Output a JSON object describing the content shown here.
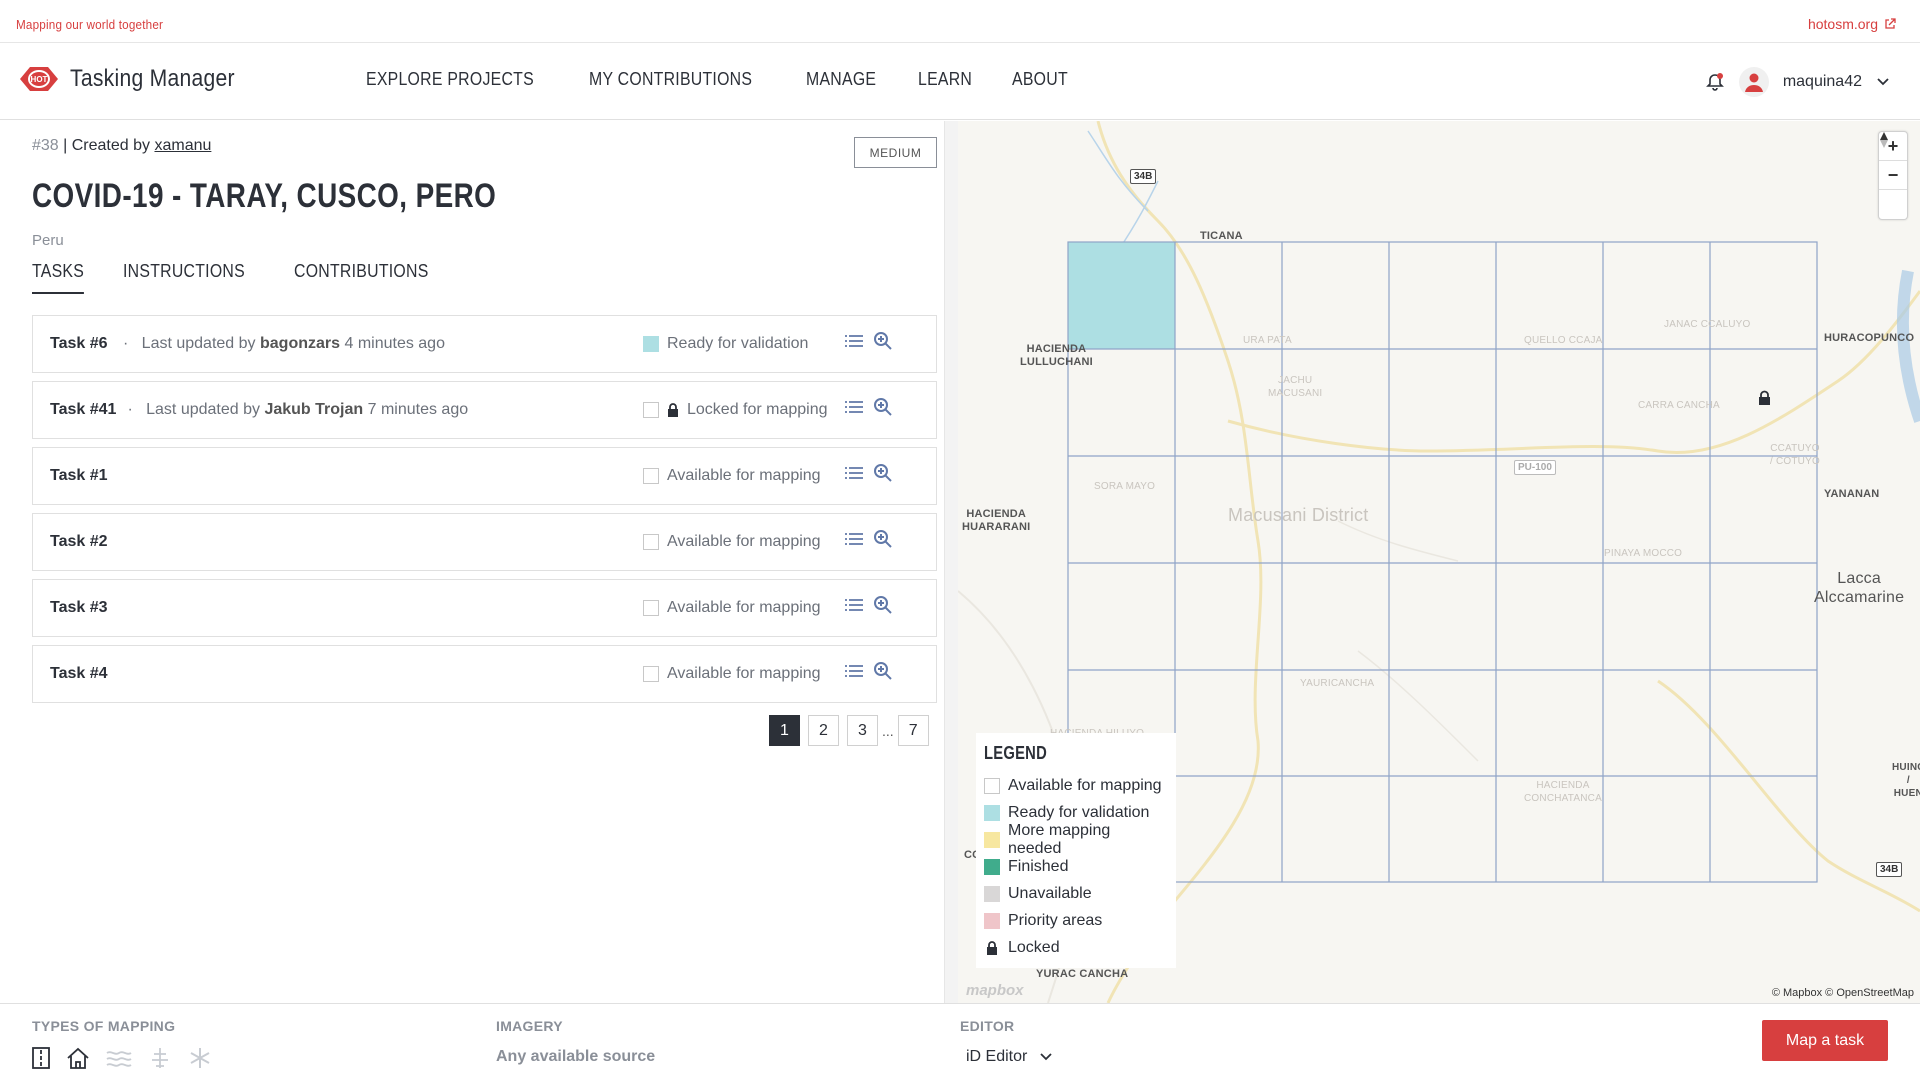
{
  "topbar": {
    "tagline": "Mapping our world together",
    "external_link": "hotosm.org"
  },
  "header": {
    "app_name": "Tasking Manager",
    "logo_text": "HOT",
    "nav": [
      "EXPLORE PROJECTS",
      "MY CONTRIBUTIONS",
      "MANAGE",
      "LEARN",
      "ABOUT"
    ],
    "username": "maquina42"
  },
  "project": {
    "id_label": "#38",
    "created_by_prefix": " | Created by ",
    "creator": "xamanu",
    "difficulty": "MEDIUM",
    "title": "COVID-19 - TARAY, CUSCO, PERO",
    "country": "Peru",
    "tabs": [
      "TASKS",
      "INSTRUCTIONS",
      "CONTRIBUTIONS"
    ]
  },
  "tasks": [
    {
      "name": "Task #6",
      "dot": "·",
      "updated_prefix": "Last updated by",
      "user": "bagonzars",
      "ago": "4 minutes ago",
      "status": "Ready for validation",
      "status_key": "ready",
      "locked": false
    },
    {
      "name": "Task #41",
      "dot": "·",
      "updated_prefix": "Last updated by",
      "user": "Jakub Trojan",
      "ago": "7 minutes ago",
      "status": "Locked for mapping",
      "status_key": "available",
      "locked": true
    },
    {
      "name": "Task #1",
      "status": "Available for mapping",
      "status_key": "available",
      "locked": false
    },
    {
      "name": "Task #2",
      "status": "Available for mapping",
      "status_key": "available",
      "locked": false
    },
    {
      "name": "Task #3",
      "status": "Available for mapping",
      "status_key": "available",
      "locked": false
    },
    {
      "name": "Task #4",
      "status": "Available for mapping",
      "status_key": "available",
      "locked": false
    }
  ],
  "pagination": {
    "pages": [
      "1",
      "2",
      "3"
    ],
    "ellipsis": "...",
    "last": "7",
    "current": "1"
  },
  "map": {
    "labels": {
      "ticana": "TICANA",
      "hacienda_lulluchani": "HACIENDA\nLULLUCHANI",
      "hacienda_huararani": "HACIENDA\nHUARARANI",
      "huracopunco": "HURACOPUNCO",
      "yananan": "YANANAN",
      "lacca": "Lacca\nAlccamarine",
      "district": "Macusani District",
      "yurac_cancha": "YURAC CANCHA",
      "ura_pata": "URA PATA",
      "quello_ccaja": "QUELLO CCAJA",
      "janac_ccaluyo": "JANAC CCALUYO",
      "jachu_macusani": "JACHU\nMACUSANI",
      "carra_cancha": "CARRA CANCHA",
      "ccatuyo": "CCATUYO\n/ COTUYO",
      "sora_mayo": "SORA MAYO",
      "pinaya_mocco": "PINAYA MOCCO",
      "yauricancha": "YAURICANCHA",
      "hacienda_hiluyo": "HACIENDA HILUYO",
      "hacienda_conchatanca": "HACIENDA\nCONCHATANCA",
      "huinc": "HUINC\n/ HUEN",
      "co": "CO"
    },
    "shields": {
      "s1": "34B",
      "s2": "PU-100",
      "s3": "34B"
    },
    "attribution": "© Mapbox © OpenStreetMap",
    "mapbox_logo": "mapbox",
    "colors": {
      "ready": "#addfe3",
      "grid": "#8fa4c8",
      "road": "#f1e4b5"
    }
  },
  "legend": {
    "title": "LEGEND",
    "items": [
      {
        "label": "Available for mapping",
        "color": "#ffffff"
      },
      {
        "label": "Ready for validation",
        "color": "#addfe3"
      },
      {
        "label": "More mapping needed",
        "color": "#f7e7a0"
      },
      {
        "label": "Finished",
        "color": "#40ac8c"
      },
      {
        "label": "Unavailable",
        "color": "#d9d7d7"
      },
      {
        "label": "Priority areas",
        "color": "#efc5c9"
      },
      {
        "label": "Locked",
        "color": "lock"
      }
    ]
  },
  "footer": {
    "types_label": "TYPES OF MAPPING",
    "imagery_label": "IMAGERY",
    "imagery_value": "Any available source",
    "editor_label": "EDITOR",
    "editor_value": "iD Editor",
    "cta": "Map a task"
  }
}
